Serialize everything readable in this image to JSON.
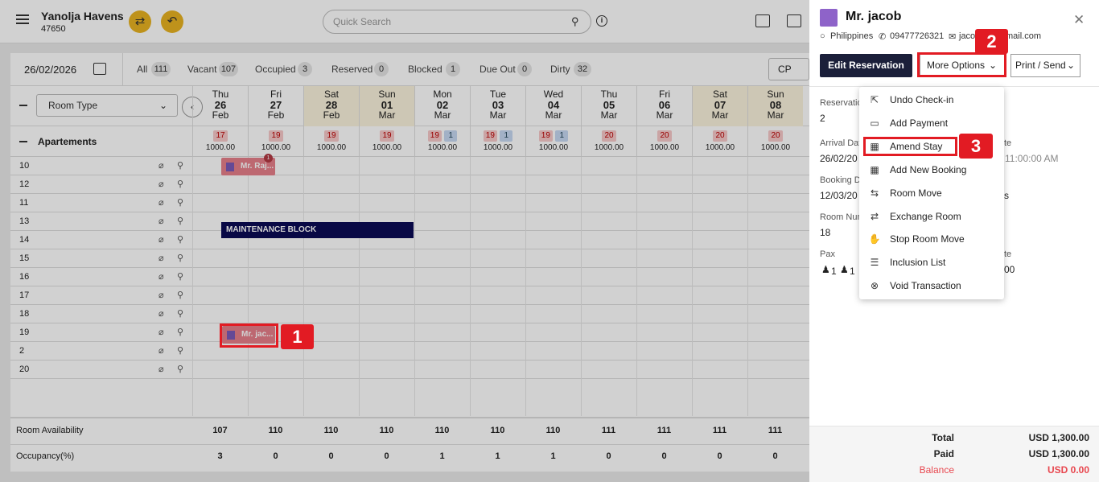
{
  "header": {
    "hotel_name": "Yanolja Havens",
    "hotel_id": "47650",
    "search_placeholder": "Quick Search"
  },
  "filters": {
    "date": "26/02/2026",
    "stats": [
      {
        "label": "All",
        "count": "111"
      },
      {
        "label": "Vacant",
        "count": "107"
      },
      {
        "label": "Occupied",
        "count": "3"
      },
      {
        "label": "Reserved",
        "count": "0"
      },
      {
        "label": "Blocked",
        "count": "1"
      },
      {
        "label": "Due Out",
        "count": "0"
      },
      {
        "label": "Dirty",
        "count": "32"
      }
    ],
    "rate_plan": "CP"
  },
  "grid": {
    "room_type_select": "Room Type",
    "section": "Apartements",
    "days": [
      {
        "dow": "Thu",
        "day": "26",
        "mon": "Feb",
        "avail": "17",
        "booked": "",
        "rate": "1000.00",
        "weekend": false
      },
      {
        "dow": "Fri",
        "day": "27",
        "mon": "Feb",
        "avail": "19",
        "booked": "",
        "rate": "1000.00",
        "weekend": false
      },
      {
        "dow": "Sat",
        "day": "28",
        "mon": "Feb",
        "avail": "19",
        "booked": "",
        "rate": "1000.00",
        "weekend": true
      },
      {
        "dow": "Sun",
        "day": "01",
        "mon": "Mar",
        "avail": "19",
        "booked": "",
        "rate": "1000.00",
        "weekend": true
      },
      {
        "dow": "Mon",
        "day": "02",
        "mon": "Mar",
        "avail": "19",
        "booked": "1",
        "rate": "1000.00",
        "weekend": false
      },
      {
        "dow": "Tue",
        "day": "03",
        "mon": "Mar",
        "avail": "19",
        "booked": "1",
        "rate": "1000.00",
        "weekend": false
      },
      {
        "dow": "Wed",
        "day": "04",
        "mon": "Mar",
        "avail": "19",
        "booked": "1",
        "rate": "1000.00",
        "weekend": false
      },
      {
        "dow": "Thu",
        "day": "05",
        "mon": "Mar",
        "avail": "20",
        "booked": "",
        "rate": "1000.00",
        "weekend": false
      },
      {
        "dow": "Fri",
        "day": "06",
        "mon": "Mar",
        "avail": "20",
        "booked": "",
        "rate": "1000.00",
        "weekend": false
      },
      {
        "dow": "Sat",
        "day": "07",
        "mon": "Mar",
        "avail": "20",
        "booked": "",
        "rate": "1000.00",
        "weekend": true
      },
      {
        "dow": "Sun",
        "day": "08",
        "mon": "Mar",
        "avail": "20",
        "booked": "",
        "rate": "1000.00",
        "weekend": true
      }
    ],
    "rooms": [
      "10",
      "12",
      "11",
      "13",
      "14",
      "15",
      "16",
      "17",
      "18",
      "19",
      "2",
      "20"
    ],
    "bookings": {
      "raj": "Mr. Raj...",
      "jacob": "Mr. jac...",
      "raj_note_count": "1"
    },
    "maintenance_label": "MAINTENANCE BLOCK",
    "footer": {
      "availability_label": "Room Availability",
      "availability": [
        "107",
        "110",
        "110",
        "110",
        "110",
        "110",
        "110",
        "111",
        "111",
        "111",
        "111"
      ],
      "occupancy_label": "Occupancy(%)",
      "occupancy": [
        "3",
        "0",
        "0",
        "0",
        "1",
        "1",
        "1",
        "0",
        "0",
        "0",
        "0"
      ]
    }
  },
  "panel": {
    "guest_name": "Mr. jacob",
    "country": "Philippines",
    "phone": "09477726321",
    "email_start": "jaco",
    "email_end": "mail.com",
    "edit_button": "Edit Reservation",
    "more_button": "More Options",
    "print_button": "Print / Send",
    "fields": {
      "reservation_label": "Reservatio",
      "reservation_value": "2",
      "arrival_label": "Arrival Dat",
      "arrival_value": "26/02/20",
      "departure_label_tail": "te",
      "departure_value_tail": "6 11:00:00 AM",
      "booking_label": "Booking D",
      "booking_value": "12/03/20",
      "source_value_tail": "s",
      "room_label": "Room Num",
      "room_value": "18",
      "pax_label": "Pax",
      "adults": "1",
      "children": "1",
      "rate_label_tail": "te",
      "rate_value_tail": "00"
    },
    "menu": [
      {
        "label": "Undo Check-in",
        "icon": "undo-checkin-icon"
      },
      {
        "label": "Add Payment",
        "icon": "payment-card-icon"
      },
      {
        "label": "Amend Stay",
        "icon": "calendar-edit-icon"
      },
      {
        "label": "Add New Booking",
        "icon": "calendar-add-icon"
      },
      {
        "label": "Room Move",
        "icon": "bed-move-icon"
      },
      {
        "label": "Exchange Room",
        "icon": "bed-exchange-icon"
      },
      {
        "label": "Stop Room Move",
        "icon": "hand-stop-icon"
      },
      {
        "label": "Inclusion List",
        "icon": "inclusion-icon"
      },
      {
        "label": "Void Transaction",
        "icon": "void-x-icon"
      }
    ],
    "totals": {
      "total_label": "Total",
      "total_value": "USD 1,300.00",
      "paid_label": "Paid",
      "paid_value": "USD 1,300.00",
      "balance_label": "Balance",
      "balance_value": "USD 0.00"
    }
  },
  "annotations": [
    "1",
    "2",
    "3"
  ],
  "colors": {
    "accent_yellow": "#e8b321",
    "booking_red": "#e77f8a",
    "maintenance_navy": "#0a0a55",
    "callout_red": "#e21b23",
    "balance_red": "#e8474f"
  }
}
